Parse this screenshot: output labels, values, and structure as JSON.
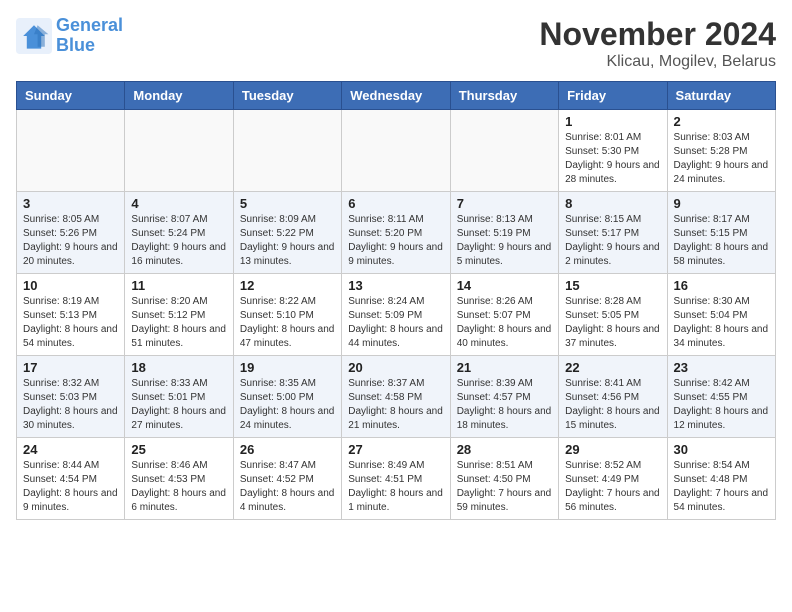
{
  "header": {
    "logo_line1": "General",
    "logo_line2": "Blue",
    "month_title": "November 2024",
    "location": "Klicau, Mogilev, Belarus"
  },
  "days_of_week": [
    "Sunday",
    "Monday",
    "Tuesday",
    "Wednesday",
    "Thursday",
    "Friday",
    "Saturday"
  ],
  "weeks": [
    [
      {
        "day": "",
        "info": ""
      },
      {
        "day": "",
        "info": ""
      },
      {
        "day": "",
        "info": ""
      },
      {
        "day": "",
        "info": ""
      },
      {
        "day": "",
        "info": ""
      },
      {
        "day": "1",
        "info": "Sunrise: 8:01 AM\nSunset: 5:30 PM\nDaylight: 9 hours and 28 minutes."
      },
      {
        "day": "2",
        "info": "Sunrise: 8:03 AM\nSunset: 5:28 PM\nDaylight: 9 hours and 24 minutes."
      }
    ],
    [
      {
        "day": "3",
        "info": "Sunrise: 8:05 AM\nSunset: 5:26 PM\nDaylight: 9 hours and 20 minutes."
      },
      {
        "day": "4",
        "info": "Sunrise: 8:07 AM\nSunset: 5:24 PM\nDaylight: 9 hours and 16 minutes."
      },
      {
        "day": "5",
        "info": "Sunrise: 8:09 AM\nSunset: 5:22 PM\nDaylight: 9 hours and 13 minutes."
      },
      {
        "day": "6",
        "info": "Sunrise: 8:11 AM\nSunset: 5:20 PM\nDaylight: 9 hours and 9 minutes."
      },
      {
        "day": "7",
        "info": "Sunrise: 8:13 AM\nSunset: 5:19 PM\nDaylight: 9 hours and 5 minutes."
      },
      {
        "day": "8",
        "info": "Sunrise: 8:15 AM\nSunset: 5:17 PM\nDaylight: 9 hours and 2 minutes."
      },
      {
        "day": "9",
        "info": "Sunrise: 8:17 AM\nSunset: 5:15 PM\nDaylight: 8 hours and 58 minutes."
      }
    ],
    [
      {
        "day": "10",
        "info": "Sunrise: 8:19 AM\nSunset: 5:13 PM\nDaylight: 8 hours and 54 minutes."
      },
      {
        "day": "11",
        "info": "Sunrise: 8:20 AM\nSunset: 5:12 PM\nDaylight: 8 hours and 51 minutes."
      },
      {
        "day": "12",
        "info": "Sunrise: 8:22 AM\nSunset: 5:10 PM\nDaylight: 8 hours and 47 minutes."
      },
      {
        "day": "13",
        "info": "Sunrise: 8:24 AM\nSunset: 5:09 PM\nDaylight: 8 hours and 44 minutes."
      },
      {
        "day": "14",
        "info": "Sunrise: 8:26 AM\nSunset: 5:07 PM\nDaylight: 8 hours and 40 minutes."
      },
      {
        "day": "15",
        "info": "Sunrise: 8:28 AM\nSunset: 5:05 PM\nDaylight: 8 hours and 37 minutes."
      },
      {
        "day": "16",
        "info": "Sunrise: 8:30 AM\nSunset: 5:04 PM\nDaylight: 8 hours and 34 minutes."
      }
    ],
    [
      {
        "day": "17",
        "info": "Sunrise: 8:32 AM\nSunset: 5:03 PM\nDaylight: 8 hours and 30 minutes."
      },
      {
        "day": "18",
        "info": "Sunrise: 8:33 AM\nSunset: 5:01 PM\nDaylight: 8 hours and 27 minutes."
      },
      {
        "day": "19",
        "info": "Sunrise: 8:35 AM\nSunset: 5:00 PM\nDaylight: 8 hours and 24 minutes."
      },
      {
        "day": "20",
        "info": "Sunrise: 8:37 AM\nSunset: 4:58 PM\nDaylight: 8 hours and 21 minutes."
      },
      {
        "day": "21",
        "info": "Sunrise: 8:39 AM\nSunset: 4:57 PM\nDaylight: 8 hours and 18 minutes."
      },
      {
        "day": "22",
        "info": "Sunrise: 8:41 AM\nSunset: 4:56 PM\nDaylight: 8 hours and 15 minutes."
      },
      {
        "day": "23",
        "info": "Sunrise: 8:42 AM\nSunset: 4:55 PM\nDaylight: 8 hours and 12 minutes."
      }
    ],
    [
      {
        "day": "24",
        "info": "Sunrise: 8:44 AM\nSunset: 4:54 PM\nDaylight: 8 hours and 9 minutes."
      },
      {
        "day": "25",
        "info": "Sunrise: 8:46 AM\nSunset: 4:53 PM\nDaylight: 8 hours and 6 minutes."
      },
      {
        "day": "26",
        "info": "Sunrise: 8:47 AM\nSunset: 4:52 PM\nDaylight: 8 hours and 4 minutes."
      },
      {
        "day": "27",
        "info": "Sunrise: 8:49 AM\nSunset: 4:51 PM\nDaylight: 8 hours and 1 minute."
      },
      {
        "day": "28",
        "info": "Sunrise: 8:51 AM\nSunset: 4:50 PM\nDaylight: 7 hours and 59 minutes."
      },
      {
        "day": "29",
        "info": "Sunrise: 8:52 AM\nSunset: 4:49 PM\nDaylight: 7 hours and 56 minutes."
      },
      {
        "day": "30",
        "info": "Sunrise: 8:54 AM\nSunset: 4:48 PM\nDaylight: 7 hours and 54 minutes."
      }
    ]
  ]
}
